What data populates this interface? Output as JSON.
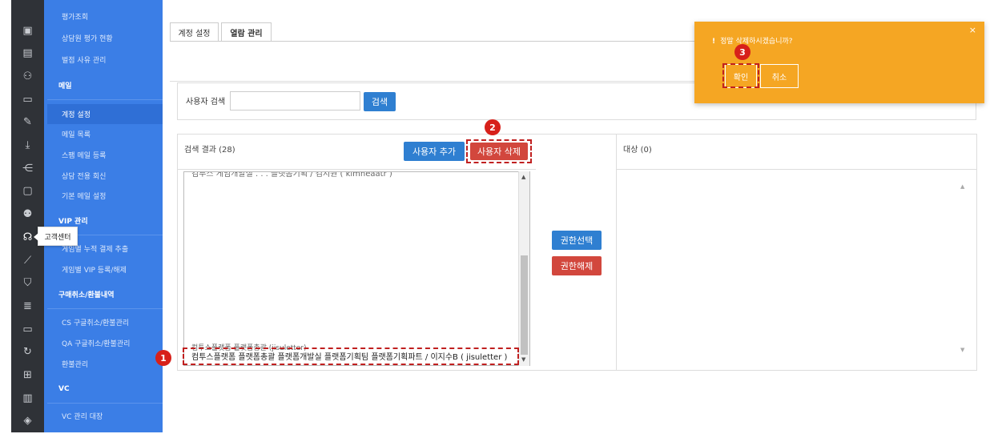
{
  "sidebar": {
    "items": [
      {
        "label": "평가조회",
        "type": "item"
      },
      {
        "label": "상담원 평가 현황",
        "type": "item"
      },
      {
        "label": "벌점 사유 관리",
        "type": "item"
      },
      {
        "label": "메일",
        "type": "head"
      },
      {
        "label": "계정 설정",
        "type": "item",
        "active": true
      },
      {
        "label": "메일 목록",
        "type": "item"
      },
      {
        "label": "스팸 메일 등록",
        "type": "item"
      },
      {
        "label": "상담 전용 회신",
        "type": "item"
      },
      {
        "label": "기본 메일 설정",
        "type": "item"
      },
      {
        "label": "VIP 관리",
        "type": "head"
      },
      {
        "label": "게임별 누적 결제 추출",
        "type": "item"
      },
      {
        "label": "게임별 VIP 등록/해제",
        "type": "item"
      },
      {
        "label": "구매취소/환불내역",
        "type": "head"
      },
      {
        "label": "CS 구글취소/환불관리",
        "type": "item"
      },
      {
        "label": "QA 구글취소/환불관리",
        "type": "item"
      },
      {
        "label": "환불관리",
        "type": "item"
      },
      {
        "label": "VC",
        "type": "head"
      },
      {
        "label": "VC 관리 대장",
        "type": "item"
      }
    ]
  },
  "iconbar": {
    "icons": [
      "dashboard-icon",
      "document-icon",
      "user-icon",
      "card-icon",
      "edit-icon",
      "download-icon",
      "share-icon",
      "chat-icon",
      "users-icon",
      "headset-icon",
      "chart-icon",
      "shield-icon",
      "database-icon",
      "monitor-icon",
      "refresh-icon",
      "gift-icon",
      "bar-chart-icon",
      "layers-icon"
    ],
    "tooltip": "고객센터"
  },
  "tabs": [
    {
      "label": "계정 설정"
    },
    {
      "label": "열람 관리"
    }
  ],
  "search": {
    "label": "사용자 검색",
    "value": "",
    "button": "검색"
  },
  "results": {
    "title": "검색 결과 (28)",
    "add_button": "사용자 추가",
    "delete_button": "사용자 삭제",
    "top_row": "컴투스 게임개발실 . . . 플랫폼기획 / 김지원 ( kimheaatr )",
    "partial_row": "컴투스플랫폼 플랫폼총괄 (jisuletter)",
    "selected_row": "컴투스플랫폼 플랫폼총괄 플랫폼개발실 플랫폼기획팀 플랫폼기획파트 / 이지수B ( jisuletter )"
  },
  "permission": {
    "grant": "권한선택",
    "revoke": "권한해제"
  },
  "target": {
    "title": "대상 (0)"
  },
  "confirm": {
    "message": "정말 삭제하시겠습니까?",
    "ok": "확인",
    "cancel": "취소",
    "close": "×",
    "color": "#f5a623"
  },
  "steps": [
    "1",
    "2",
    "3"
  ]
}
